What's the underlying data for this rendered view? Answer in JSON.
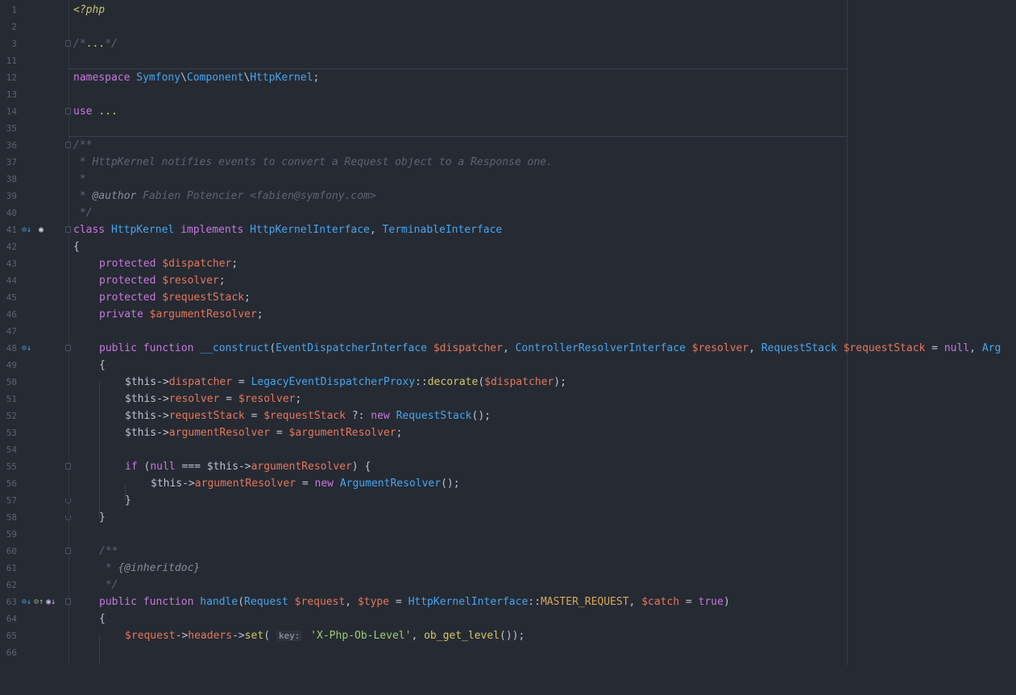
{
  "editor": {
    "line_numbers": [
      "1",
      "2",
      "3",
      "11",
      "12",
      "13",
      "14",
      "35",
      "36",
      "37",
      "38",
      "39",
      "40",
      "41",
      "42",
      "43",
      "44",
      "45",
      "46",
      "47",
      "48",
      "49",
      "50",
      "51",
      "52",
      "53",
      "54",
      "55",
      "56",
      "57",
      "58",
      "59",
      "60",
      "61",
      "62",
      "63",
      "64",
      "65",
      "66"
    ],
    "lines": {
      "l1": [
        "<?php"
      ],
      "l3": [
        "/*",
        "...",
        "*/"
      ],
      "l12": [
        "namespace ",
        "Symfony",
        "\\",
        "Component",
        "\\",
        "HttpKernel",
        ";"
      ],
      "l14": [
        "use ",
        "..."
      ],
      "l36": [
        "/**"
      ],
      "l37": [
        " * HttpKernel notifies events to convert a Request object to a Response one."
      ],
      "l38": [
        " *"
      ],
      "l39": [
        " * ",
        "@author",
        " Fabien Potencier <fabien@symfony.com>"
      ],
      "l40": [
        " */"
      ],
      "l41": [
        "class ",
        "HttpKernel",
        " implements ",
        "HttpKernelInterface",
        ", ",
        "TerminableInterface"
      ],
      "l42": [
        "{"
      ],
      "l43": [
        "protected ",
        "$dispatcher",
        ";"
      ],
      "l44": [
        "protected ",
        "$resolver",
        ";"
      ],
      "l45": [
        "protected ",
        "$requestStack",
        ";"
      ],
      "l46": [
        "private ",
        "$argumentResolver",
        ";"
      ],
      "l48": [
        "public ",
        "function ",
        "__construct",
        "(",
        "EventDispatcherInterface",
        " ",
        "$dispatcher",
        ", ",
        "ControllerResolverInterface",
        " ",
        "$resolver",
        ", ",
        "RequestStack",
        " ",
        "$requestStack",
        " = ",
        "null",
        ", ",
        "Arg"
      ],
      "l49": [
        "{"
      ],
      "l50": [
        "$this",
        "->",
        "dispatcher",
        " = ",
        "LegacyEventDispatcherProxy",
        "::",
        "decorate",
        "(",
        "$dispatcher",
        ");"
      ],
      "l51": [
        "$this",
        "->",
        "resolver",
        " = ",
        "$resolver",
        ";"
      ],
      "l52": [
        "$this",
        "->",
        "requestStack",
        " = ",
        "$requestStack",
        " ?: ",
        "new ",
        "RequestStack",
        "();"
      ],
      "l53": [
        "$this",
        "->",
        "argumentResolver",
        " = ",
        "$argumentResolver",
        ";"
      ],
      "l55": [
        "if ",
        "(",
        "null",
        " === ",
        "$this",
        "->",
        "argumentResolver",
        ") {"
      ],
      "l56": [
        "$this",
        "->",
        "argumentResolver",
        " = ",
        "new ",
        "ArgumentResolver",
        "();"
      ],
      "l57": [
        "}"
      ],
      "l58": [
        "}"
      ],
      "l60": [
        "/**"
      ],
      "l61": [
        " * ",
        "{@inheritdoc}"
      ],
      "l62": [
        " */"
      ],
      "l63": [
        "public ",
        "function ",
        "handle",
        "(",
        "Request",
        " ",
        "$request",
        ", ",
        "$type",
        " = ",
        "HttpKernelInterface",
        "::",
        "MASTER_REQUEST",
        ", ",
        "$catch",
        " = ",
        "true",
        ")"
      ],
      "l64": [
        "{"
      ],
      "l65": [
        "$request",
        "->",
        "headers",
        "->",
        "set",
        "( ",
        "key:",
        " ",
        "'X-Php-Ob-Level'",
        ", ",
        "ob_get_level",
        "());"
      ]
    },
    "gutter_icons": {
      "l41": [
        "implemented-interface-icon",
        "overridden-class-icon"
      ],
      "l48": [
        "implemented-method-icon"
      ],
      "l63": [
        "implemented-method-icon",
        "overrides-method-icon",
        "implementing-method-icon"
      ]
    }
  },
  "colors": {
    "background": "#262a33",
    "keyword": "#c678dd",
    "class": "#45a6ee",
    "variable": "#e5775b",
    "string": "#9acc76",
    "constant": "#d3a85c",
    "comment": "#5c6370"
  }
}
